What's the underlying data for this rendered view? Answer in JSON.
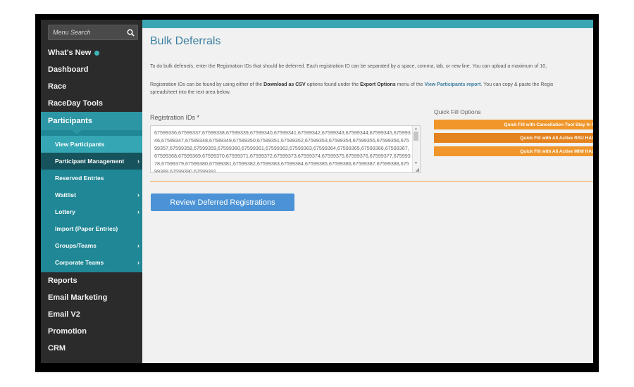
{
  "sidebar": {
    "search_placeholder": "Menu Search",
    "top_items": [
      {
        "label": "What's New"
      },
      {
        "label": "Dashboard"
      },
      {
        "label": "Race"
      },
      {
        "label": "RaceDay Tools"
      }
    ],
    "active_section": "Participants",
    "sub_items": [
      {
        "label": "View Participants"
      },
      {
        "label": "Participant Management"
      },
      {
        "label": "Reserved Entries"
      },
      {
        "label": "Waitlist"
      },
      {
        "label": "Lottery"
      },
      {
        "label": "Import (Paper Entries)"
      },
      {
        "label": "Groups/Teams"
      },
      {
        "label": "Corporate Teams"
      }
    ],
    "bottom_items": [
      {
        "label": "Reports"
      },
      {
        "label": "Email Marketing"
      },
      {
        "label": "Email V2"
      },
      {
        "label": "Promotion"
      },
      {
        "label": "CRM"
      }
    ],
    "accent_color": "#2d96a5",
    "new_dot_color": "#3db5b8"
  },
  "page": {
    "title": "Bulk Deferrals",
    "intro": "To do bulk deferrals, enter the Registration IDs that should be deferred. Each registration ID can be separated by a space, comma, tab, or new line. You can upload a maximum of 10,",
    "help": {
      "part1": "Registration IDs can be found by using either of the ",
      "download_csv": "Download as CSV",
      "part2": " options found under the ",
      "export_options": "Export Options",
      "part3": " menu of the ",
      "report_link": "View Participants report",
      "part4": ". You can copy & paste the Regis",
      "line2": "spreadsheet into the text area below."
    },
    "reg_ids_label": "Registration IDs *",
    "reg_ids_value": "67599336,67599337,67599338,67599339,67599340,67599341,67599342,67599343,67599344,67599345,67599346,67599347,67599348,67599349,67599350,67599351,67599352,67599353,67599354,67599355,67599356,67599357,67599358,67599359,67599360,67599361,67599362,67599363,67599364,67599365,67599366,67599367,67599368,67599369,67599370,67599371,67599372,67599373,67599374,67599375,67599376,67599377,67599378,67599379,67599380,67599381,67599382,67599383,67599384,67599385,67599386,67599387,67599388,67599389,67599390,67599391",
    "quick_fill_label": "Quick Fill Options",
    "quick_fill_buttons": [
      {
        "label": "Quick Fill with Cancellation Tool Stay In F"
      },
      {
        "label": "Quick Fill with All Active RSU HAL"
      },
      {
        "label": "Quick Fill with All Active MINI HAL"
      }
    ],
    "review_button": "Review Deferred Registrations",
    "colors": {
      "title": "#3a7fa0",
      "quick_fill": "#f0962b",
      "review_button": "#4b93d6",
      "top_bar": "#3ba5b3"
    }
  }
}
